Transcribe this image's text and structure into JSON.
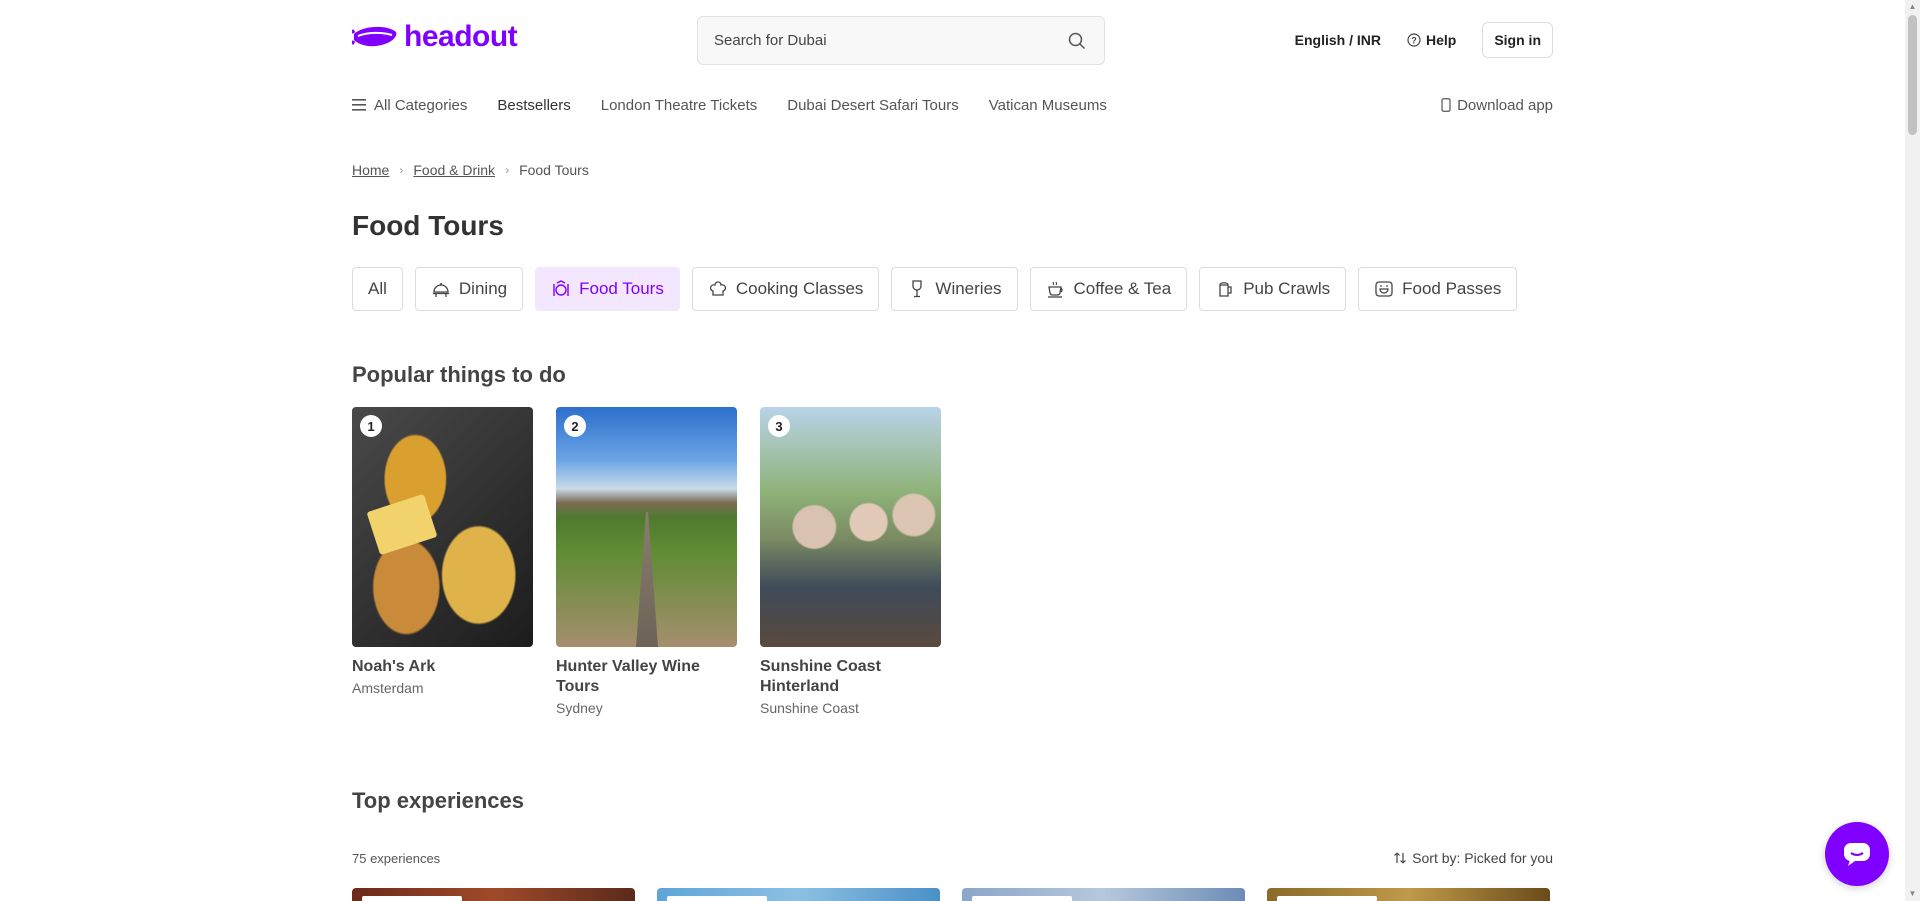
{
  "brand": {
    "name": "headout",
    "color": "#8000ff"
  },
  "search": {
    "placeholder": "Search for Dubai"
  },
  "header": {
    "language_currency": "English / INR",
    "help_label": "Help",
    "signin_label": "Sign in"
  },
  "nav": {
    "all_categories": "All Categories",
    "items": [
      "Bestsellers",
      "London Theatre Tickets",
      "Dubai Desert Safari Tours",
      "Vatican Museums"
    ],
    "download_app": "Download app"
  },
  "breadcrumb": [
    "Home",
    "Food & Drink",
    "Food Tours"
  ],
  "page_title": "Food Tours",
  "chips": [
    {
      "label": "All",
      "icon": "none",
      "active": false
    },
    {
      "label": "Dining",
      "icon": "dining-icon",
      "active": false
    },
    {
      "label": "Food Tours",
      "icon": "food-tours-icon",
      "active": true
    },
    {
      "label": "Cooking Classes",
      "icon": "chef-hat-icon",
      "active": false
    },
    {
      "label": "Wineries",
      "icon": "wine-glass-icon",
      "active": false
    },
    {
      "label": "Coffee & Tea",
      "icon": "coffee-cup-icon",
      "active": false
    },
    {
      "label": "Pub Crawls",
      "icon": "beer-mug-icon",
      "active": false
    },
    {
      "label": "Food Passes",
      "icon": "food-pass-icon",
      "active": false
    }
  ],
  "popular": {
    "title": "Popular things to do",
    "cards": [
      {
        "rank": "1",
        "title": "Noah's Ark",
        "location": "Amsterdam"
      },
      {
        "rank": "2",
        "title": "Hunter Valley Wine Tours",
        "location": "Sydney"
      },
      {
        "rank": "3",
        "title": "Sunshine Coast Hinterland",
        "location": "Sunshine Coast"
      }
    ]
  },
  "top_experiences": {
    "title": "Top experiences",
    "count_label": "75 experiences",
    "sort_label": "Sort by: Picked for you"
  },
  "colors": {
    "accent": "#8000ff",
    "active_chip_bg": "#f3e6ff"
  }
}
